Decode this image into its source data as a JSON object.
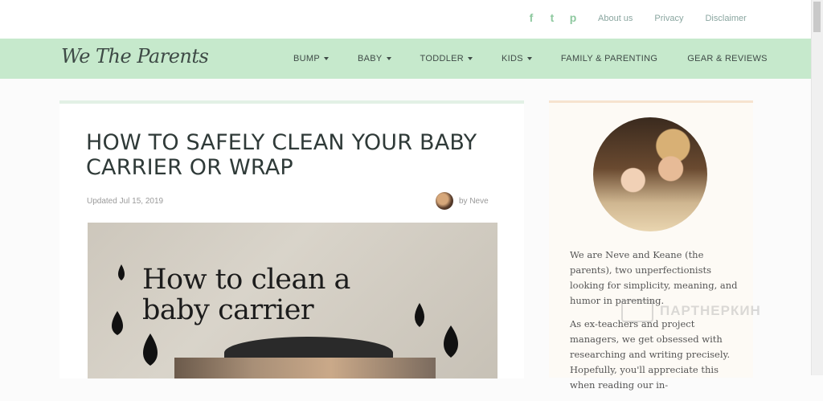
{
  "header": {
    "social": [
      {
        "icon": "facebook-icon",
        "glyph": "f"
      },
      {
        "icon": "twitter-icon",
        "glyph": "t"
      },
      {
        "icon": "pinterest-icon",
        "glyph": "p"
      }
    ],
    "links": [
      "About us",
      "Privacy",
      "Disclaimer"
    ]
  },
  "nav": {
    "logo": "We The Parents",
    "items": [
      {
        "label": "BUMP",
        "dropdown": true
      },
      {
        "label": "BABY",
        "dropdown": true
      },
      {
        "label": "TODDLER",
        "dropdown": true
      },
      {
        "label": "KIDS",
        "dropdown": true
      },
      {
        "label": "FAMILY & PARENTING",
        "dropdown": false
      },
      {
        "label": "GEAR & REVIEWS",
        "dropdown": false
      }
    ]
  },
  "article": {
    "title": "HOW TO SAFELY CLEAN YOUR BABY CARRIER OR WRAP",
    "updated": "Updated Jul 15, 2019",
    "author": "by Neve",
    "hero_text_line1": "How to clean a",
    "hero_text_line2": "baby carrier"
  },
  "sidebar": {
    "bio_p1": "We are Neve and Keane (the parents), two unperfectionists looking for simplicity, meaning, and humor in parenting.",
    "bio_p2": "As ex-teachers and project managers, we get obsessed with researching and writing precisely. Hopefully, you'll appreciate this when reading our in-"
  },
  "watermark": "ПАРТНЕРКИН",
  "colors": {
    "nav_bg": "#c6e9cc",
    "accent": "#8fc9a0",
    "title": "#2f3a38"
  }
}
